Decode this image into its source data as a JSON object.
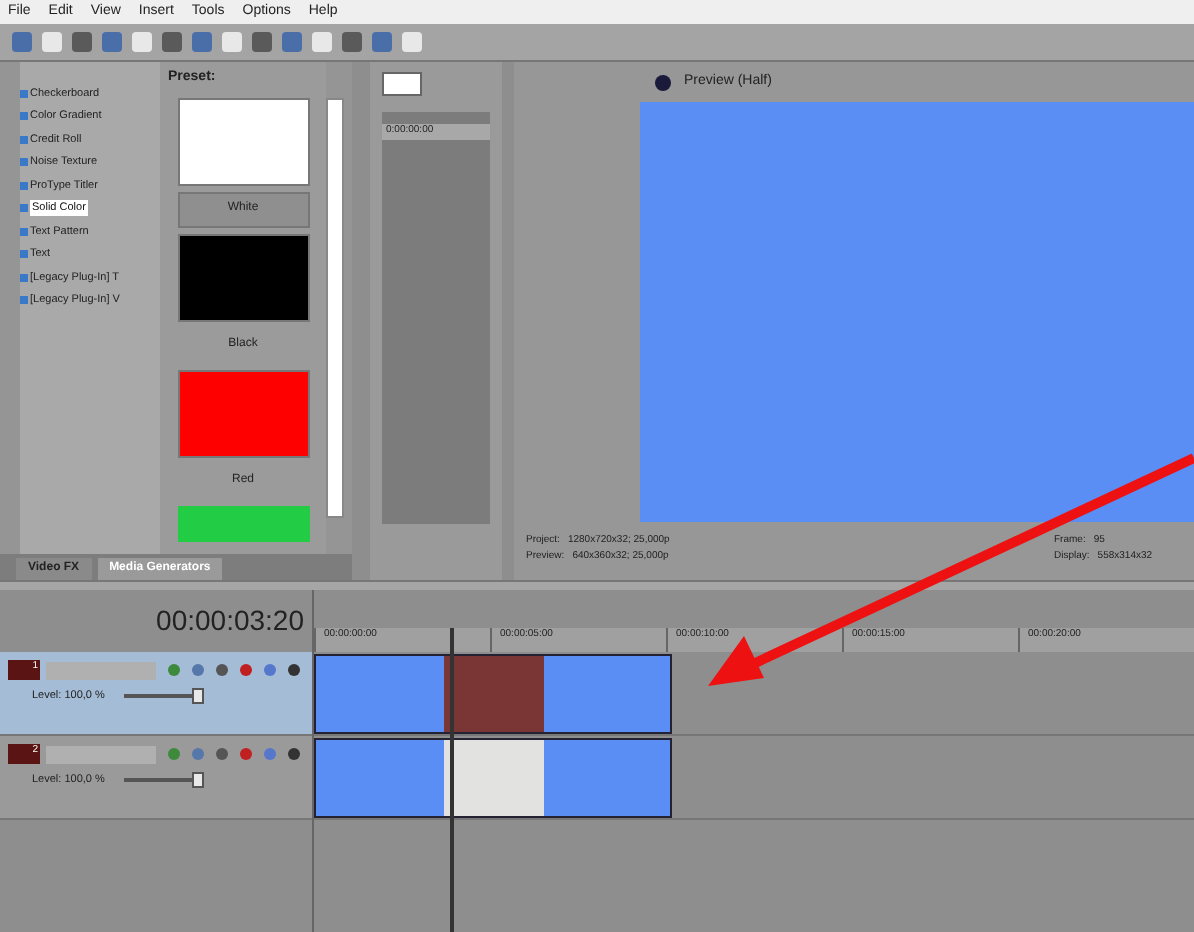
{
  "menu": [
    "File",
    "Edit",
    "View",
    "Insert",
    "Tools",
    "Options",
    "Help"
  ],
  "generators": [
    {
      "label": "Checkerboard",
      "selected": false
    },
    {
      "label": "Color Gradient",
      "selected": false
    },
    {
      "label": "Credit Roll",
      "selected": false
    },
    {
      "label": "Noise Texture",
      "selected": false
    },
    {
      "label": "ProType Titler",
      "selected": false
    },
    {
      "label": "Solid Color",
      "selected": true
    },
    {
      "label": "Text Pattern",
      "selected": false
    },
    {
      "label": "Text",
      "selected": false
    },
    {
      "label": "[Legacy Plug-In] T",
      "selected": false
    },
    {
      "label": "[Legacy Plug-In] V",
      "selected": false
    }
  ],
  "presets": {
    "title": "Preset:",
    "items": [
      {
        "label": "White",
        "color": "#ffffff"
      },
      {
        "label": "Black",
        "color": "#000000"
      },
      {
        "label": "Red",
        "color": "#ff0000"
      },
      {
        "color": "#22cc44"
      }
    ]
  },
  "tabs": [
    {
      "label": "Video FX",
      "selected": false
    },
    {
      "label": "Media Generators",
      "selected": true
    }
  ],
  "trimmer": {
    "timecode": "0:00:00:00"
  },
  "preview": {
    "mode": "Preview (Half)",
    "info": [
      {
        "label": "Project:",
        "value": "1280x720x32; 25,000p"
      },
      {
        "label": "Preview:",
        "value": "640x360x32; 25,000p"
      }
    ],
    "info_right": [
      {
        "label": "Frame:",
        "value": "95"
      },
      {
        "label": "Display:",
        "value": "558x314x32"
      }
    ]
  },
  "timeline": {
    "time": "00:00:03:20",
    "ruler": [
      "00:00:00:00",
      "00:00:05:00",
      "00:00:10:00",
      "00:00:15:00",
      "00:00:20:00"
    ],
    "tracks": [
      {
        "number": "1",
        "kind": "video",
        "selected": true,
        "level_text": "Level: 100,0 %",
        "level": 1,
        "clips": [
          {
            "color": "#5a8ef5"
          },
          {
            "color": "#7a3535"
          },
          {
            "color": "#5a8ef5"
          }
        ]
      },
      {
        "number": "2",
        "kind": "video",
        "selected": false,
        "level_text": "Level: 100,0 %",
        "level": 1,
        "clips": [
          {
            "color": "#5a8ef5"
          },
          {
            "color": "#e2e2e0"
          },
          {
            "color": "#5a8ef5"
          }
        ]
      }
    ]
  }
}
